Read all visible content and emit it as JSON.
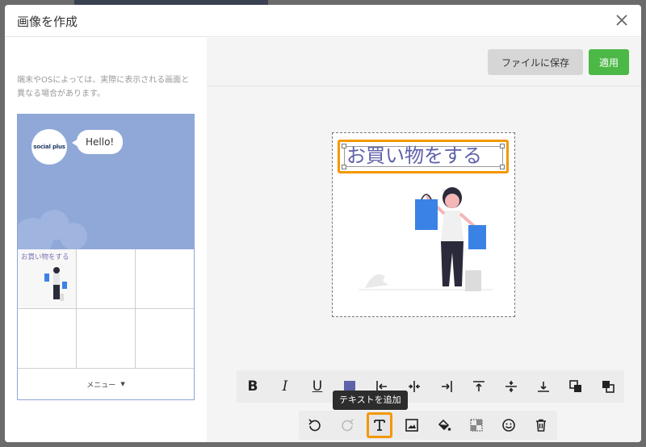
{
  "modal": {
    "title": "画像を作成",
    "note": "端末やOSによっては、実際に表示される画面と異なる場合があります。"
  },
  "preview": {
    "avatar_text": "social plus",
    "bubble_text": "Hello!",
    "cell_label": "お買い物をする",
    "menu_label": "メニュー",
    "chat_bg": "#8fa8d8"
  },
  "editor": {
    "save_label": "ファイルに保存",
    "apply_label": "適用",
    "canvas_text": "お買い物をする",
    "tooltip": "テキストを追加",
    "text_color": "#5e62a8",
    "highlight_color": "#f39800"
  },
  "toolbar_top": [
    {
      "name": "bold-button",
      "icon": "bold-icon",
      "label": "B"
    },
    {
      "name": "italic-button",
      "icon": "italic-icon",
      "label": "I"
    },
    {
      "name": "underline-button",
      "icon": "underline-icon",
      "label": "U"
    },
    {
      "name": "text-color-button",
      "icon": "color-swatch-icon"
    },
    {
      "name": "align-left-button",
      "icon": "align-left-icon"
    },
    {
      "name": "align-center-button",
      "icon": "align-center-icon"
    },
    {
      "name": "align-right-button",
      "icon": "align-right-icon"
    },
    {
      "name": "align-top-button",
      "icon": "align-top-icon"
    },
    {
      "name": "align-middle-button",
      "icon": "align-middle-icon"
    },
    {
      "name": "align-bottom-button",
      "icon": "align-bottom-icon"
    },
    {
      "name": "bring-forward-button",
      "icon": "bring-forward-icon"
    },
    {
      "name": "send-backward-button",
      "icon": "send-backward-icon"
    }
  ],
  "toolbar_bottom": [
    {
      "name": "undo-button",
      "icon": "undo-icon"
    },
    {
      "name": "redo-button",
      "icon": "redo-icon"
    },
    {
      "name": "add-text-button",
      "icon": "text-icon",
      "active": true
    },
    {
      "name": "add-image-button",
      "icon": "image-icon"
    },
    {
      "name": "fill-button",
      "icon": "paint-bucket-icon"
    },
    {
      "name": "transparency-button",
      "icon": "transparency-icon"
    },
    {
      "name": "emoji-button",
      "icon": "emoji-icon"
    },
    {
      "name": "delete-button",
      "icon": "trash-icon"
    }
  ]
}
